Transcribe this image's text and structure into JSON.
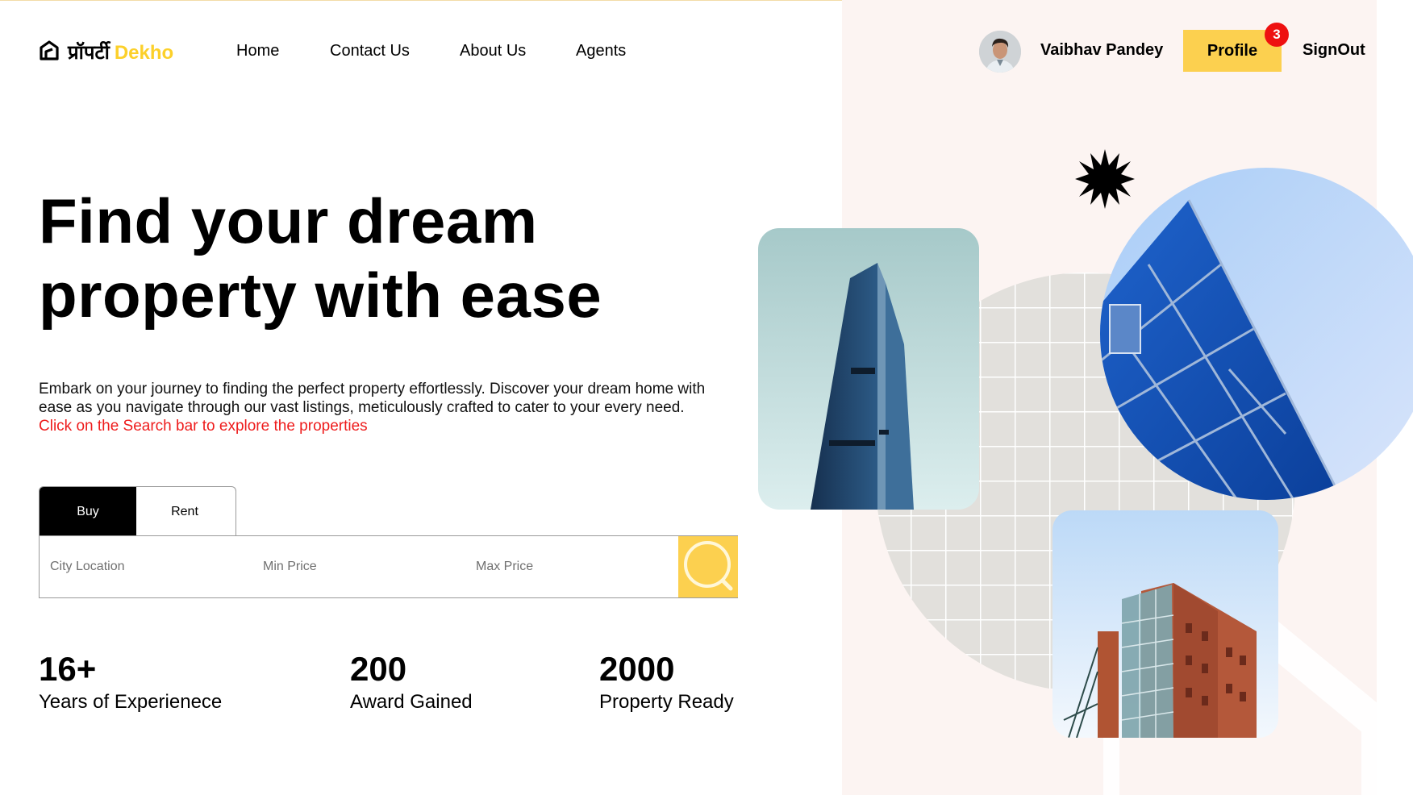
{
  "header": {
    "logo_hindi": "प्रॉपर्टी",
    "logo_english": "Dekho",
    "nav": [
      "Home",
      "Contact Us",
      "About Us",
      "Agents"
    ],
    "user_name": "Vaibhav Pandey",
    "profile_label": "Profile",
    "notification_count": "3",
    "signout_label": "SignOut"
  },
  "hero": {
    "title_line1": "Find your dream",
    "title_line2": "property with ease",
    "description": "Embark on your journey to finding the perfect property effortlessly. Discover your dream home with ease as you navigate through our vast listings, meticulously crafted to cater to your every need.",
    "cta_text": "Click on the Search bar to explore the properties"
  },
  "search": {
    "tabs": [
      "Buy",
      "Rent"
    ],
    "active_tab": "Buy",
    "location_placeholder": "City Location",
    "min_price_placeholder": "Min Price",
    "max_price_placeholder": "Max Price"
  },
  "stats": [
    {
      "value": "16+",
      "label": "Years of Experienece"
    },
    {
      "value": "200",
      "label": "Award Gained"
    },
    {
      "value": "2000",
      "label": "Property Ready"
    }
  ],
  "colors": {
    "accent": "#fcd04f",
    "logo_accent": "#fcd02a",
    "badge": "#ee1010",
    "cta": "#ee1c1c",
    "panel_bg": "#fcf4f2"
  },
  "icons": [
    "house-logo-icon",
    "search-icon",
    "starburst-icon"
  ]
}
